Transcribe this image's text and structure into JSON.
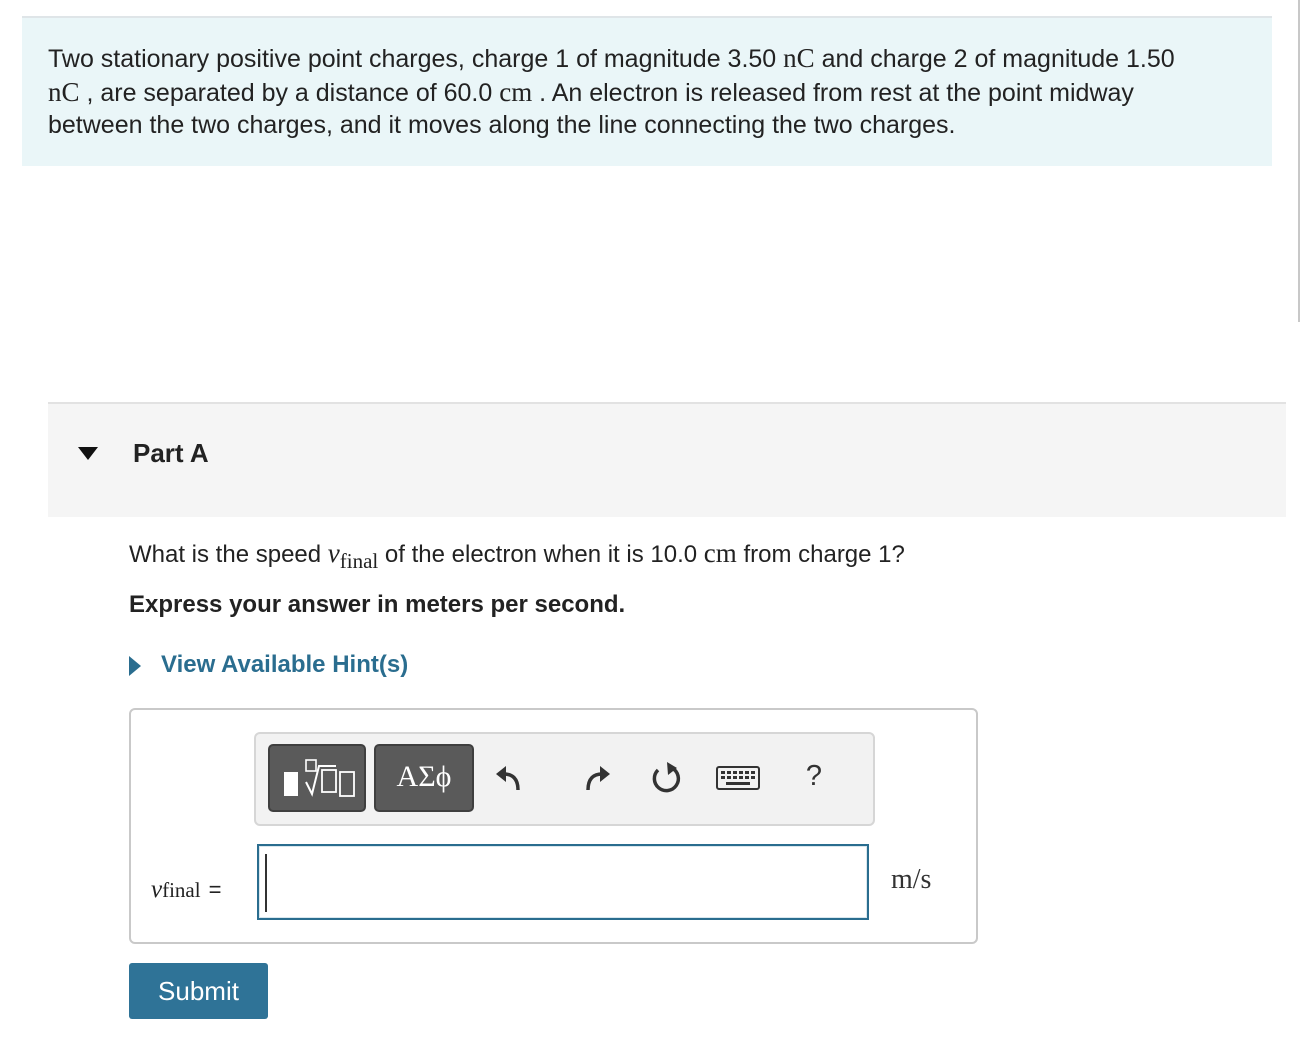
{
  "problem": {
    "line1_a": "Two stationary positive point charges, charge 1 of magnitude 3.50 ",
    "unit_nC": "nC",
    "line1_b": " and charge 2 of magnitude 1.50",
    "line2_a": " , are separated by a distance of 60.0 ",
    "unit_cm": "cm",
    "line2_b": " . An electron is released from rest at the point midway",
    "line3": "between the two charges, and it moves along the line connecting the two charges."
  },
  "part": {
    "title": "Part A",
    "question_a": "What is the speed ",
    "var_symbol": "v",
    "var_subscript": "final",
    "question_b": " of the electron when it is 10.0 ",
    "question_unit": "cm",
    "question_c": " from charge 1?",
    "instruction": "Express your answer in meters per second.",
    "hint_label": "View Available Hint(s)"
  },
  "toolbar": {
    "symbols_label": "ΑΣϕ",
    "help_label": "?"
  },
  "answer": {
    "equals": "=",
    "value": "",
    "unit": "m/s"
  },
  "submit_label": "Submit",
  "colors": {
    "problem_bg": "#eaf6f8",
    "link": "#2a6d8f",
    "submit_bg": "#2f7397",
    "toolbar_button": "#5a5a5a"
  },
  "icons": [
    "caret-down-icon",
    "caret-right-icon",
    "templates-icon",
    "undo-icon",
    "redo-icon",
    "reset-icon",
    "keyboard-icon",
    "help-icon"
  ]
}
